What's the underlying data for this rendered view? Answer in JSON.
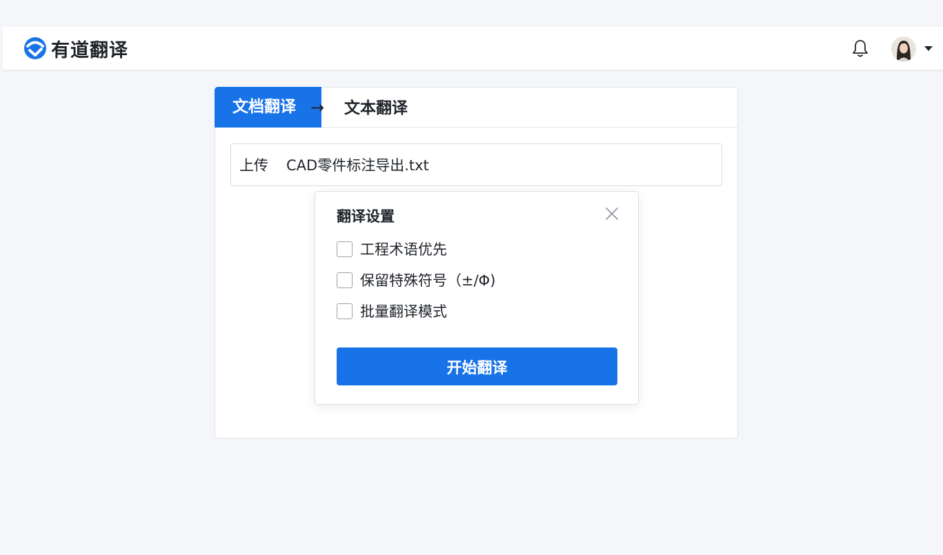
{
  "app": {
    "logo_text": "有道翻译",
    "colors": {
      "accent": "#1873e8",
      "text": "#1f2329"
    }
  },
  "header": {
    "icons": [
      "youdao-logo-icon",
      "bell-icon",
      "avatar",
      "caret-down-icon"
    ]
  },
  "tabs": {
    "document_label": "文档翻译",
    "arrow": "→",
    "text_label": "文本翻译",
    "active": "document"
  },
  "upload": {
    "label": "上传",
    "filename": "CAD零件标注导出.txt"
  },
  "dialog": {
    "title": "翻译设置",
    "options": [
      {
        "label": "工程术语优先",
        "checked": false
      },
      {
        "label": "保留特殊符号（±/Φ)",
        "checked": false
      },
      {
        "label": "批量翻译模式",
        "checked": false
      }
    ],
    "start_button": "开始翻译"
  }
}
